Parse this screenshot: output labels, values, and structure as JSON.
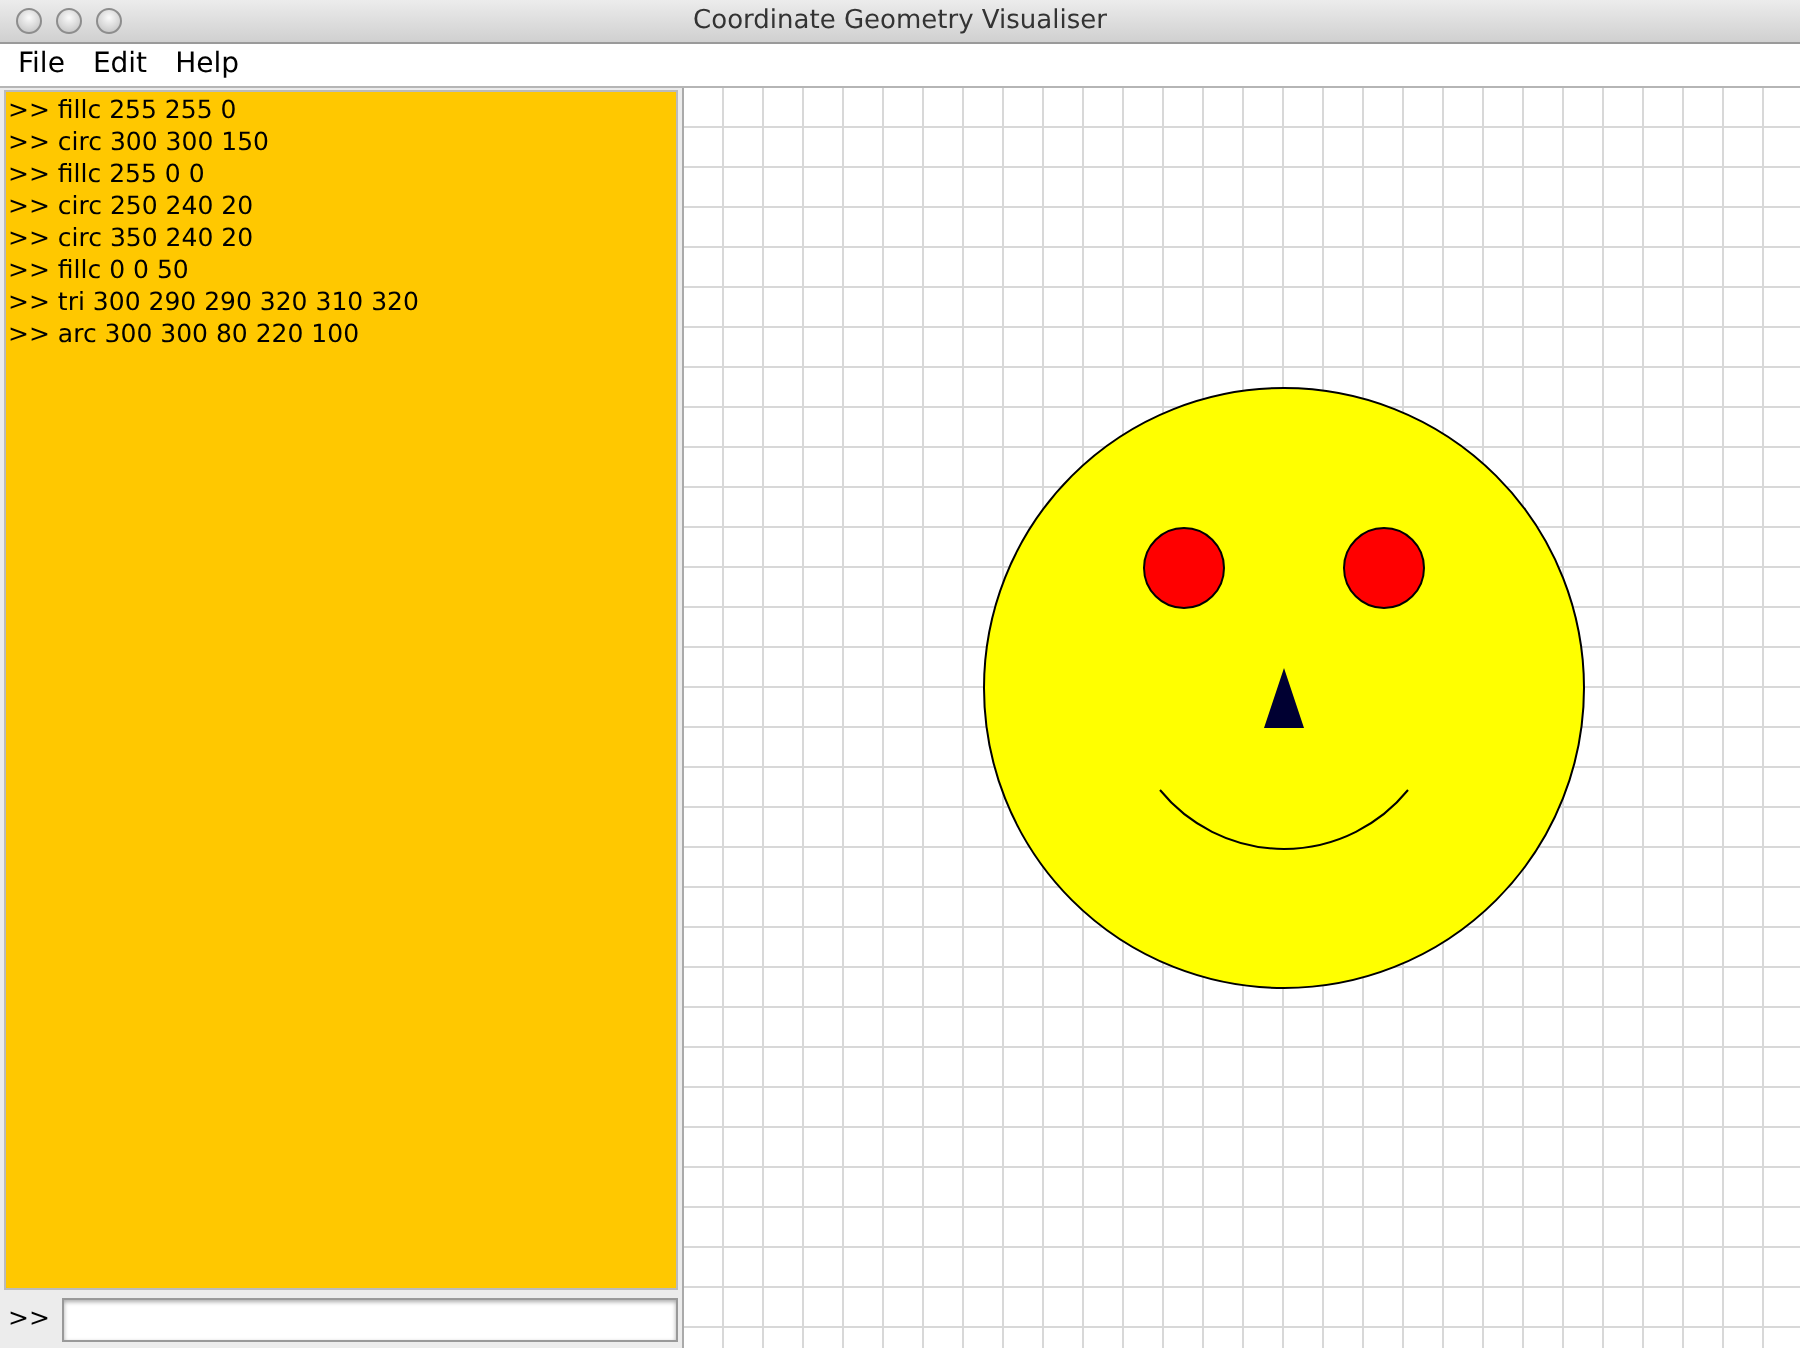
{
  "window": {
    "title": "Coordinate Geometry Visualiser"
  },
  "menu": [
    "File",
    "Edit",
    "Help"
  ],
  "console": {
    "lines": [
      ">> fillc 255 255 0",
      ">> circ 300 300 150",
      ">> fillc 255 0 0",
      ">> circ 250 240 20",
      ">> circ 350 240 20",
      ">> fillc 0 0 50",
      ">> tri 300 290 290 320 310 320",
      ">> arc 300 300 80 220 100"
    ]
  },
  "command_bar": {
    "prompt": ">>"
  }
}
